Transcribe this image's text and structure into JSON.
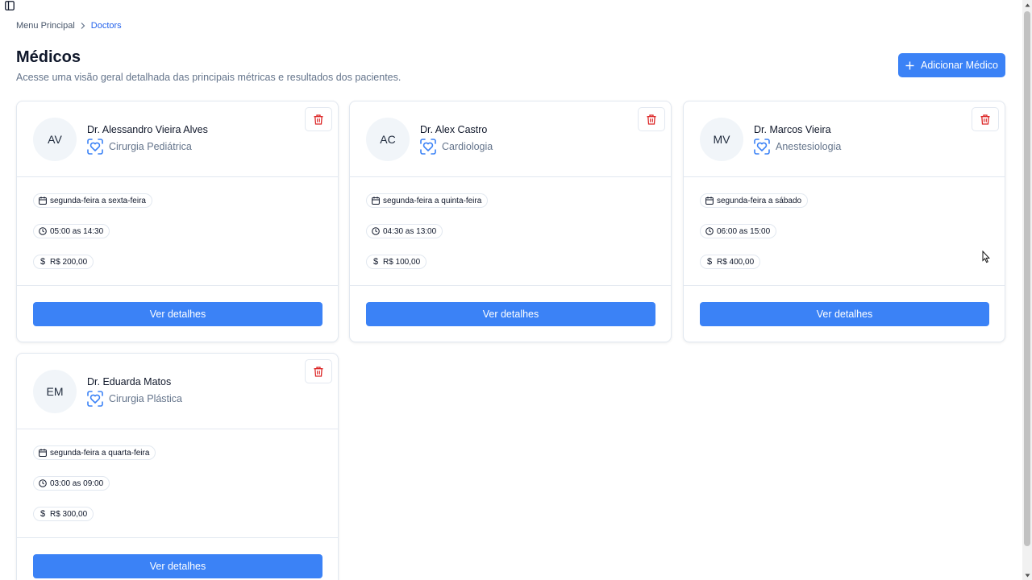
{
  "breadcrumb": {
    "root": "Menu Principal",
    "current": "Doctors"
  },
  "header": {
    "title": "Médicos",
    "subtitle": "Acesse uma visão geral detalhada das principais métricas e resultados dos pacientes.",
    "add_button": "Adicionar Médico"
  },
  "colors": {
    "primary": "#3b82f6",
    "danger": "#dc2626",
    "border": "#e2e8f0",
    "muted": "#64748b"
  },
  "icons": {
    "sidebar": "sidebar-toggle-icon",
    "breadcrumb_sep": "chevron-right-icon",
    "add": "plus-icon",
    "delete": "trash-icon",
    "specialty": "heart-scan-icon",
    "days": "calendar-icon",
    "hours": "clock-icon",
    "price": "dollar-icon"
  },
  "doctors": [
    {
      "initials": "AV",
      "name": "Dr. Alessandro Vieira Alves",
      "specialty": "Cirurgia Pediátrica",
      "days": "segunda-feira a sexta-feira",
      "hours": "05:00 as 14:30",
      "price": "R$ 200,00",
      "details_button": "Ver detalhes"
    },
    {
      "initials": "AC",
      "name": "Dr. Alex Castro",
      "specialty": "Cardiologia",
      "days": "segunda-feira a quinta-feira",
      "hours": "04:30 as 13:00",
      "price": "R$ 100,00",
      "details_button": "Ver detalhes"
    },
    {
      "initials": "MV",
      "name": "Dr. Marcos Vieira",
      "specialty": "Anestesiologia",
      "days": "segunda-feira a sábado",
      "hours": "06:00 as 15:00",
      "price": "R$ 400,00",
      "details_button": "Ver detalhes"
    },
    {
      "initials": "EM",
      "name": "Dr. Eduarda Matos",
      "specialty": "Cirurgia Plástica",
      "days": "segunda-feira a quarta-feira",
      "hours": "03:00 as 09:00",
      "price": "R$ 300,00",
      "details_button": "Ver detalhes"
    }
  ]
}
